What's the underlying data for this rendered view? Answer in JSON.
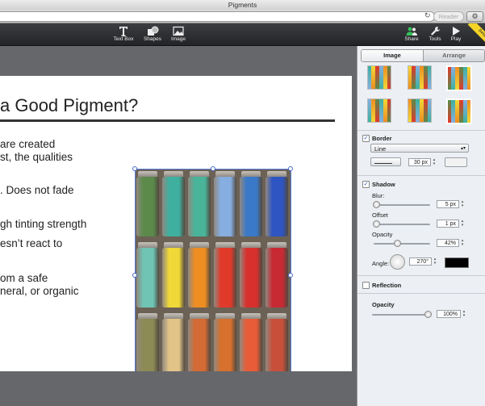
{
  "window": {
    "title": "Pigments"
  },
  "browser": {
    "reader_label": "Reader"
  },
  "toolbar": {
    "textbox_label": "Text Box",
    "shapes_label": "Shapes",
    "image_label": "Image",
    "share_label": "Share",
    "tools_label": "Tools",
    "play_label": "Play",
    "beta_label": "Beta"
  },
  "slide": {
    "title": "a Good Pigment?",
    "bullets": [
      "are created",
      "st, the qualities",
      ". Does not fade",
      "gh tinting strength",
      "esn’t react to",
      "om a safe",
      "neral, or organic"
    ]
  },
  "inspector": {
    "tabs": [
      "Image",
      "Arrange"
    ],
    "border": {
      "label": "Border",
      "style": "Line",
      "width": "30 px"
    },
    "shadow": {
      "label": "Shadow",
      "blur_label": "Blur:",
      "blur": "5 px",
      "offset_label": "Offset",
      "offset": "1 px",
      "opacity_label": "Opacity",
      "opacity": "42%",
      "angle_label": "Angle:",
      "angle": "270°",
      "color": "#000000"
    },
    "reflection": {
      "label": "Reflection"
    },
    "opacity": {
      "label": "Opacity",
      "value": "100%"
    }
  }
}
